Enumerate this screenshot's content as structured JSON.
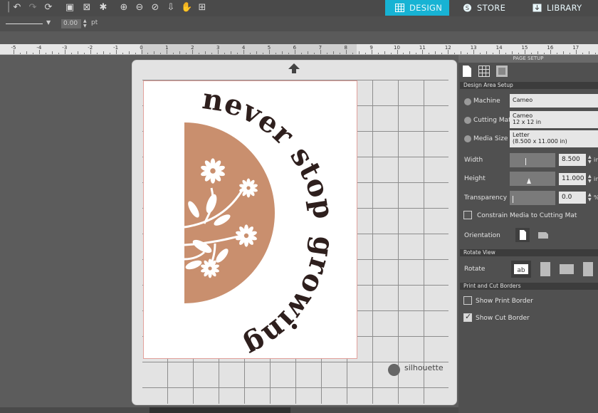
{
  "top_tabs": {
    "design": "DESIGN",
    "store": "STORE",
    "library": "LIBRARY"
  },
  "toolbar": {
    "line_width_value": "0.00",
    "line_width_unit": "pt"
  },
  "ruler_labels": [
    "-5",
    "-4",
    "-3",
    "-2",
    "-1",
    "0",
    "1",
    "2",
    "3",
    "4",
    "5",
    "6",
    "7",
    "8",
    "9",
    "10",
    "11",
    "12",
    "13",
    "14",
    "15",
    "16",
    "17"
  ],
  "design": {
    "text_top": "never stop",
    "text_bottom": "growing",
    "accent_color": "#c98f6e",
    "text_color": "#2e1f1d"
  },
  "brand": {
    "logo_text": "silhouette"
  },
  "panel": {
    "title": "PAGE SETUP",
    "design_area_section": "Design Area Setup",
    "machine_label": "Machine",
    "machine_value": "Cameo",
    "cutting_mat_label": "Cutting Mat",
    "cutting_mat_value_line1": "Cameo",
    "cutting_mat_value_line2": "12 x 12  in",
    "media_size_label": "Media Size",
    "media_size_value_line1": "Letter",
    "media_size_value_line2": "(8.500 x 11.000 in)",
    "width_label": "Width",
    "width_value": "8.500",
    "height_label": "Height",
    "height_value": "11.000",
    "transparency_label": "Transparency",
    "transparency_value": "0.0",
    "constrain_label": "Constrain Media to Cutting Mat",
    "constrain_checked": false,
    "orientation_label": "Orientation",
    "rotate_view_section": "Rotate View",
    "rotate_label": "Rotate",
    "print_cut_section": "Print and Cut Borders",
    "show_print_border_label": "Show Print Border",
    "show_print_border_checked": false,
    "show_cut_border_label": "Show Cut Border",
    "show_cut_border_checked": true
  }
}
